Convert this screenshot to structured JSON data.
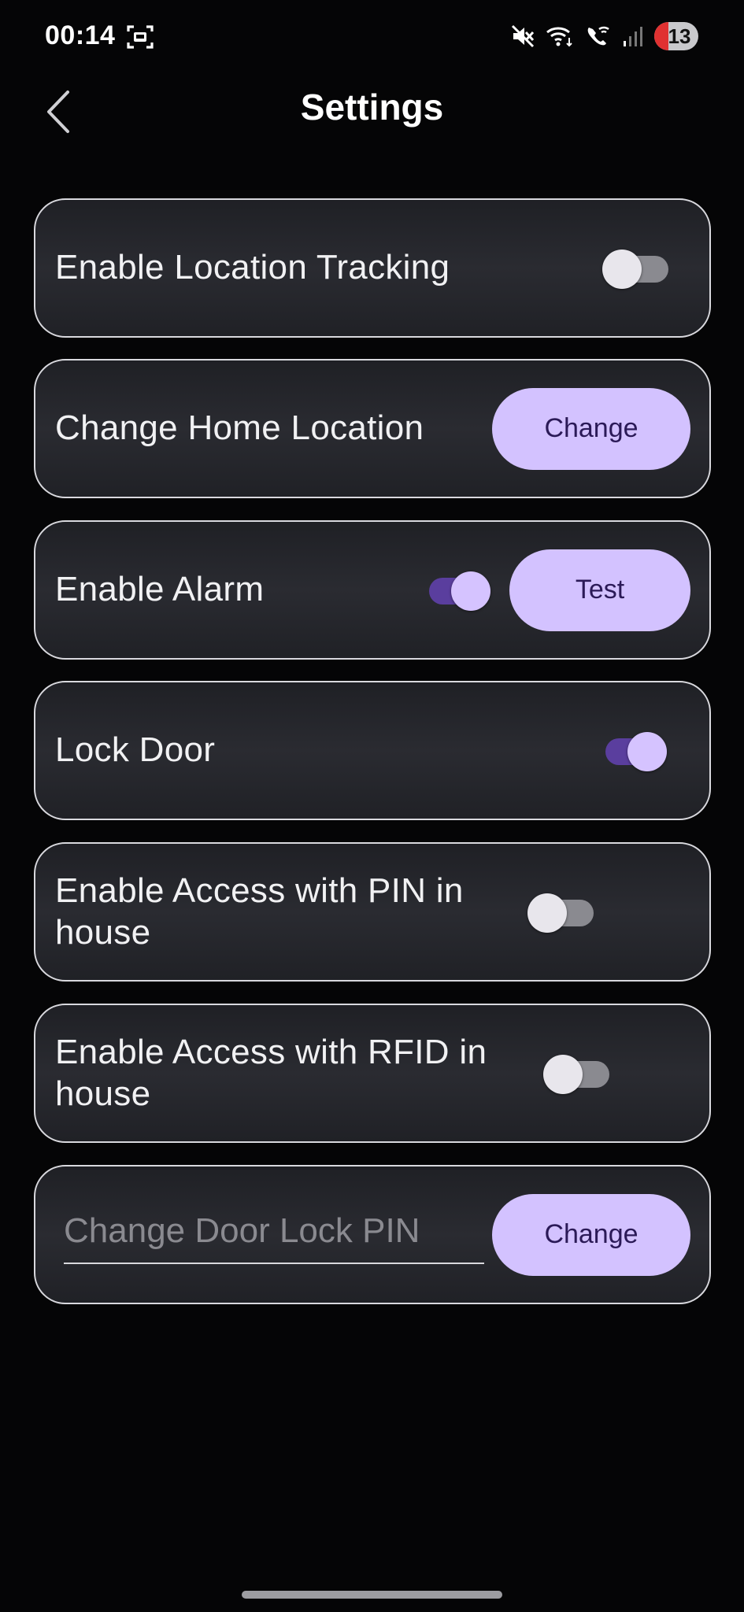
{
  "status_bar": {
    "time": "00:14",
    "notification_count": "13",
    "icons": [
      "screenshot-icon",
      "mute-icon",
      "wifi-icon",
      "wifi-call-icon",
      "signal-icon"
    ]
  },
  "header": {
    "title": "Settings",
    "back_icon": "chevron-left-icon"
  },
  "settings": {
    "location_tracking": {
      "label": "Enable Location Tracking",
      "enabled": false
    },
    "home_location": {
      "label": "Change Home Location",
      "button": "Change"
    },
    "alarm": {
      "label": "Enable Alarm",
      "enabled": true,
      "button": "Test"
    },
    "lock_door": {
      "label": "Lock Door",
      "enabled": true
    },
    "pin_access": {
      "label": "Enable Access with PIN in house",
      "enabled": false
    },
    "rfid_access": {
      "label": "Enable Access with RFID in house",
      "enabled": false
    },
    "door_pin": {
      "placeholder": "Change Door Lock PIN",
      "value": "",
      "button": "Change"
    }
  },
  "colors": {
    "accent": "#d3c2ff",
    "accent_dark": "#5a3e9e",
    "button_text": "#2b1a57",
    "background": "#050506",
    "card_border": "#d9d9de"
  }
}
